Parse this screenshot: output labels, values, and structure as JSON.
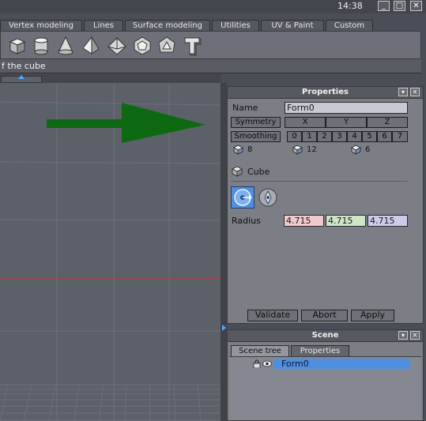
{
  "window": {
    "clock": "14:38",
    "controls": {
      "minimize": "_",
      "maximize": "□",
      "close": "✕"
    }
  },
  "tabs": [
    "Vertex modeling",
    "Lines",
    "Surface modeling",
    "Utilities",
    "UV & Paint",
    "Custom"
  ],
  "toolbar": {
    "tools": [
      "box-tool-icon",
      "cylinder-tool-icon",
      "cone-tool-icon",
      "pyramid-tool-icon",
      "octahedron-tool-icon",
      "dodecahedron-tool-icon",
      "icosahedron-tool-icon",
      "text-tool-icon"
    ]
  },
  "hint": "f the cube",
  "colors": {
    "arrow": "#0d6a12",
    "axis_line": "#d23030",
    "selection": "#4f8fdf"
  },
  "properties": {
    "title": "Properties",
    "name_label": "Name",
    "name_value": "Form0",
    "symmetry_label": "Symmetry",
    "axes": [
      "X",
      "Y",
      "Z"
    ],
    "smoothing_label": "Smoothing",
    "smoothing_levels": [
      "0",
      "1",
      "2",
      "3",
      "4",
      "5",
      "6",
      "7"
    ],
    "counts": {
      "vertices": "8",
      "edges": "12",
      "faces": "6"
    },
    "object_type": "Cube",
    "radius_label": "Radius",
    "radius": {
      "x": "4.715",
      "y": "4.715",
      "z": "4.715"
    },
    "buttons": {
      "validate": "Validate",
      "abort": "Abort",
      "apply": "Apply"
    }
  },
  "scene": {
    "title": "Scene",
    "tabs": [
      "Scene tree",
      "Properties"
    ],
    "tree": [
      {
        "name": "Form0",
        "selected": true
      }
    ]
  }
}
